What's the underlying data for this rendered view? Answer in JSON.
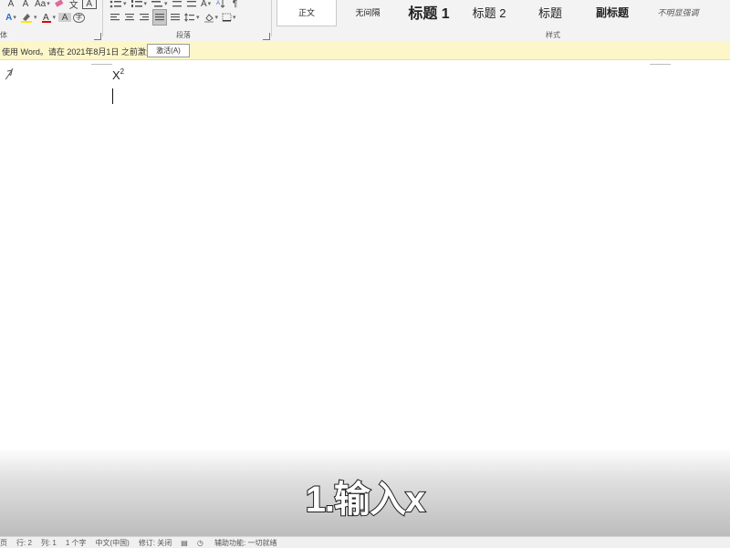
{
  "ribbon": {
    "font_group_label": "体",
    "paragraph_group_label": "段落",
    "styles_group_label": "样式",
    "styles": [
      "正文",
      "无间隔",
      "标题 1",
      "标题 2",
      "标题",
      "副标题",
      "不明显强调"
    ]
  },
  "notice": {
    "message": "使用 Word。请在 2021年8月1日 之前激活。",
    "activate_label": "激活(A)"
  },
  "document": {
    "base": "X",
    "superscript": "2"
  },
  "caption": "1.输入x",
  "status": {
    "page": "页",
    "line": "行: 2",
    "column": "列: 1",
    "words": "1 个字",
    "language": "中文(中国)",
    "track_changes": "修订: 关闭",
    "accessibility": "辅助功能: 一切就绪"
  }
}
